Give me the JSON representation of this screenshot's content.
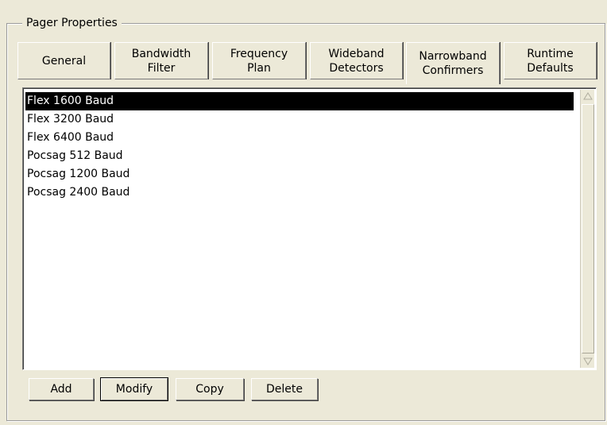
{
  "group": {
    "title": "Pager Properties"
  },
  "tabs": [
    {
      "label": "General",
      "active": false
    },
    {
      "label": "Bandwidth\nFilter",
      "active": false
    },
    {
      "label": "Frequency\nPlan",
      "active": false
    },
    {
      "label": "Wideband\nDetectors",
      "active": false
    },
    {
      "label": "Narrowband\nConfirmers",
      "active": true
    },
    {
      "label": "Runtime\nDefaults",
      "active": false
    }
  ],
  "list": {
    "items": [
      {
        "label": "Flex 1600 Baud",
        "selected": true
      },
      {
        "label": "Flex 3200 Baud",
        "selected": false
      },
      {
        "label": "Flex 6400 Baud",
        "selected": false
      },
      {
        "label": "Pocsag 512 Baud",
        "selected": false
      },
      {
        "label": "Pocsag 1200 Baud",
        "selected": false
      },
      {
        "label": "Pocsag 2400 Baud",
        "selected": false
      }
    ]
  },
  "buttons": {
    "add": "Add",
    "modify": "Modify",
    "copy": "Copy",
    "delete": "Delete"
  },
  "colors": {
    "background": "#ece9d8",
    "selection": "#000000",
    "list_background": "#ffffff"
  },
  "icons": {
    "scroll_up": "triangle-up-icon",
    "scroll_down": "triangle-down-icon"
  }
}
